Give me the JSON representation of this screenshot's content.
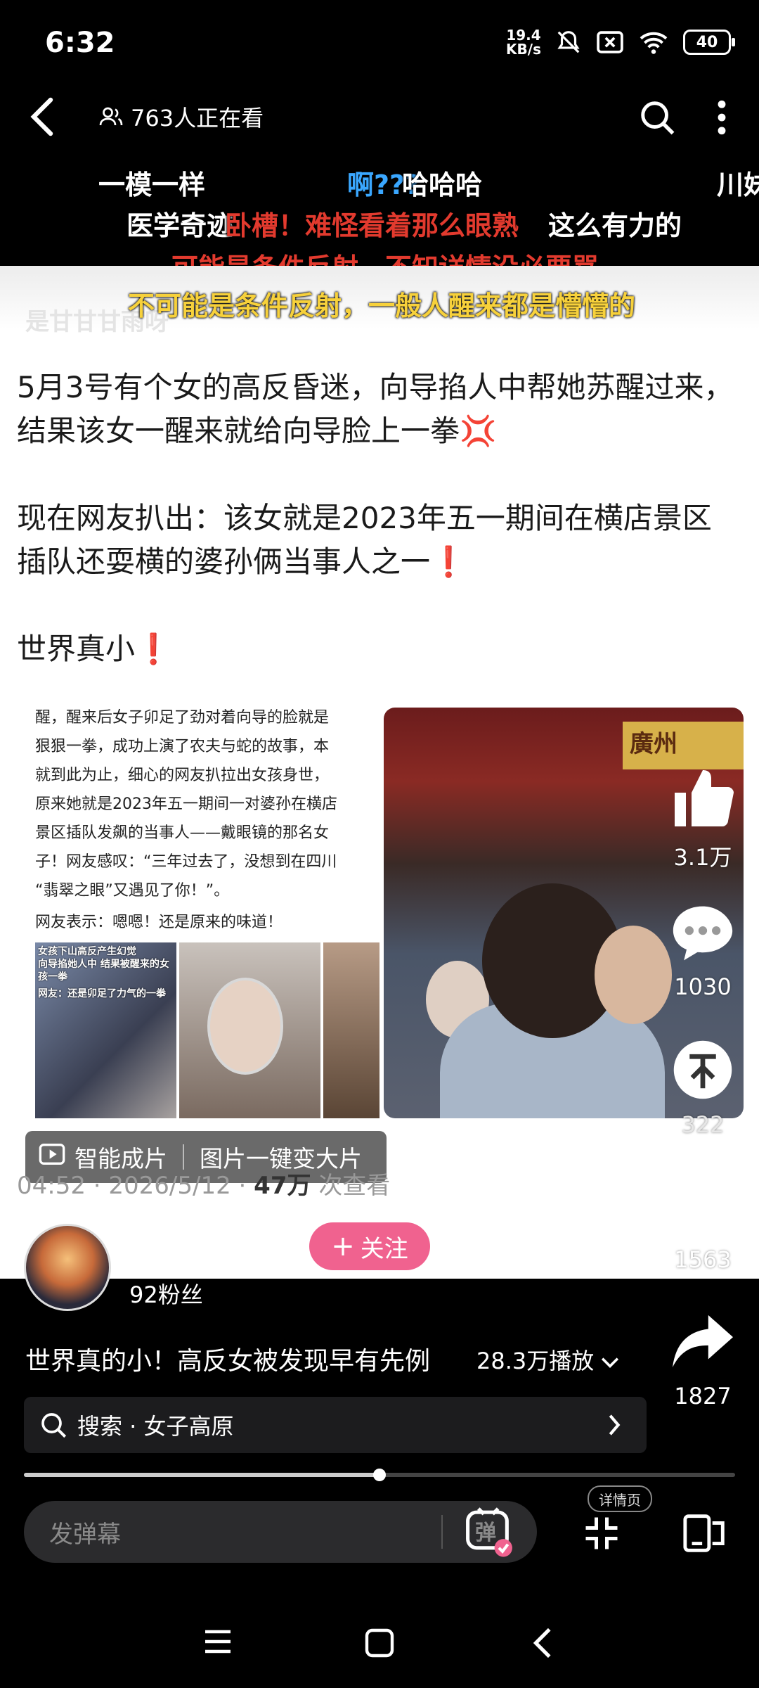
{
  "status_bar": {
    "time": "6:32",
    "net_speed_value": "19.4",
    "net_speed_unit": "KB/s",
    "battery": "40"
  },
  "top_bar": {
    "viewers": "763人正在看"
  },
  "danmaku": [
    {
      "text": "一模一样",
      "color": "#ffffff"
    },
    {
      "text": "啊???",
      "color": "#3aa7ff"
    },
    {
      "text": "哈哈哈",
      "color": "#ffffff"
    },
    {
      "text": "川妹",
      "color": "#ffffff"
    },
    {
      "text": "医学奇迹",
      "color": "#ffffff"
    },
    {
      "text": "卧槽！难怪看着那么眼熟",
      "color": "#e23a2e"
    },
    {
      "text": "这么有力的",
      "color": "#ffffff"
    },
    {
      "text": "可能是条件反射，不知详情没必要骂",
      "color": "#e23a2e"
    },
    {
      "text": "不可能是条件反射，一般人醒来都是懵懵的",
      "color": "#f7d13b"
    }
  ],
  "post": {
    "watermark": "是甘甘甘雨呀",
    "paragraph1": "5月3号有个女的高反昏迷，向导掐人中帮她苏醒过来，结果该女一醒来就给向导脸上一拳",
    "paragraph1_emoji": "💢",
    "paragraph2": "现在网友扒出：该女就是2023年五一期间在横店景区插队还耍横的婆孙俩当事人之一",
    "paragraph2_emoji": "❗",
    "paragraph3": "世界真小",
    "paragraph3_emoji": "❗"
  },
  "article": {
    "lines": [
      "醒，醒来后女子卯足了劲对着向导的脸就是",
      "狠狠一拳，成功上演了农夫与蛇的故事，本",
      "就到此为止，细心的网友扒拉出女孩身世，",
      "原来她就是2023年五一期间一对婆孙在横店",
      "景区插队发飙的当事人——戴眼镜的那名女",
      "子！网友感叹：“三年过去了，没想到在四川",
      "“翡翠之眼”又遇见了你！”。"
    ],
    "note": "网友表示：嗯嗯！还是原来的味道！",
    "img_caption1": "女孩下山高反产生幻觉",
    "img_caption2": "向导掐她人中 结果被醒来的女孩一拳",
    "img_caption3": "网友：还是卯足了力气的一拳"
  },
  "video": {
    "sign": "廣州"
  },
  "overlay": {
    "smart_label": "智能成片",
    "enlarge_label": "图片一键变大片",
    "meta_time": "04:52 · 2026/5/12 ·",
    "meta_views": "47万",
    "meta_suffix": "次查看"
  },
  "rail": {
    "likes": "3.1万",
    "comments": "1030",
    "coins": "322",
    "favorites": "1563",
    "shares": "1827"
  },
  "author": {
    "name": "是甘甘甘雨呀",
    "follow_label": "关注",
    "fans": "92粉丝"
  },
  "video_info": {
    "title": "世界真的小！高反女被发现早有先例",
    "plays": "28.3万播放"
  },
  "search": {
    "text": "搜索 · 女子高原"
  },
  "progress": 0.5,
  "danmu_input": {
    "placeholder": "发弹幕",
    "button_glyph": "弹"
  },
  "detail_badge": "详情页",
  "colors": {
    "follow": "#f0628f",
    "danmaku_red": "#e23a2e",
    "danmaku_yellow": "#f7d13b",
    "danmaku_blue": "#3aa7ff"
  }
}
